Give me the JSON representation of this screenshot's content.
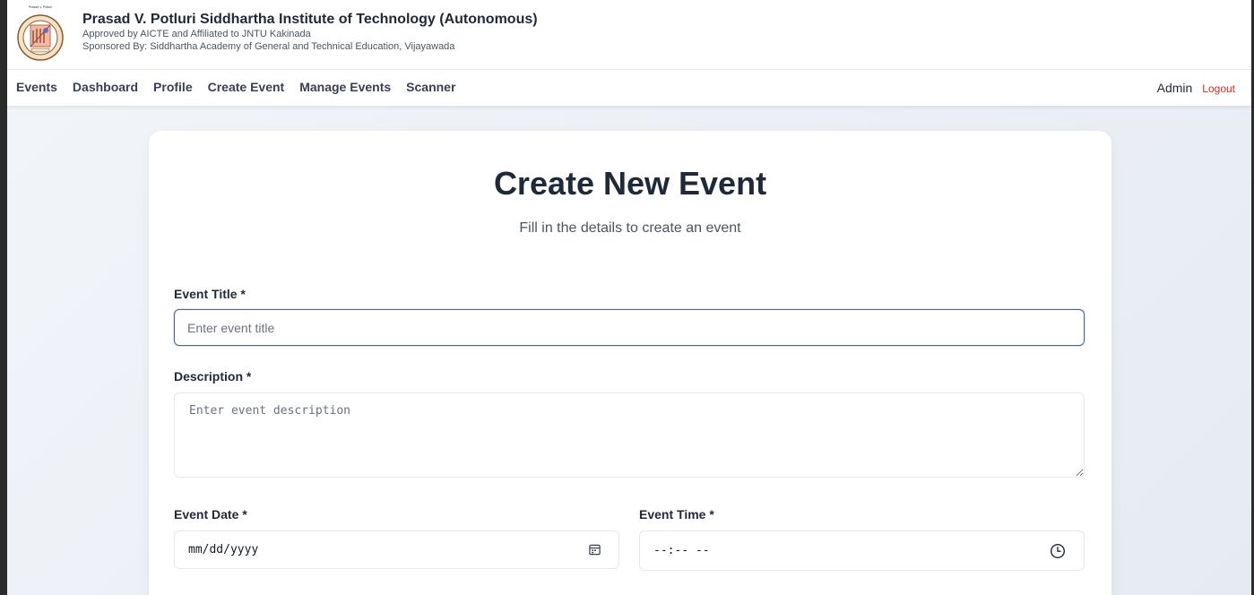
{
  "header": {
    "institution_name": "Prasad V. Potluri Siddhartha Institute of Technology (Autonomous)",
    "approval_line": "Approved by AICTE and Affiliated to JNTU Kakinada",
    "sponsor_line": "Sponsored By: Siddhartha Academy of General and Technical Education, Vijayawada",
    "logo_icon": "institute-seal-logo"
  },
  "nav": {
    "links": [
      "Events",
      "Dashboard",
      "Profile",
      "Create Event",
      "Manage Events",
      "Scanner"
    ],
    "user_name": "Admin",
    "logout_label": "Logout"
  },
  "form": {
    "title": "Create New Event",
    "subtitle": "Fill in the details to create an event",
    "event_title_label": "Event Title *",
    "event_title_placeholder": "Enter event title",
    "event_title_value": "",
    "description_label": "Description *",
    "description_placeholder": "Enter event description",
    "event_date_label": "Event Date *",
    "event_date_placeholder": "mm/dd/yyyy",
    "event_time_label": "Event Time *",
    "event_time_placeholder": "--:-- --"
  },
  "icons": {
    "date": "calendar-icon",
    "time": "clock-icon"
  },
  "colors": {
    "logout": "#dc2626",
    "focused_border": "#4b6584",
    "page_background": "#e9eef4"
  }
}
